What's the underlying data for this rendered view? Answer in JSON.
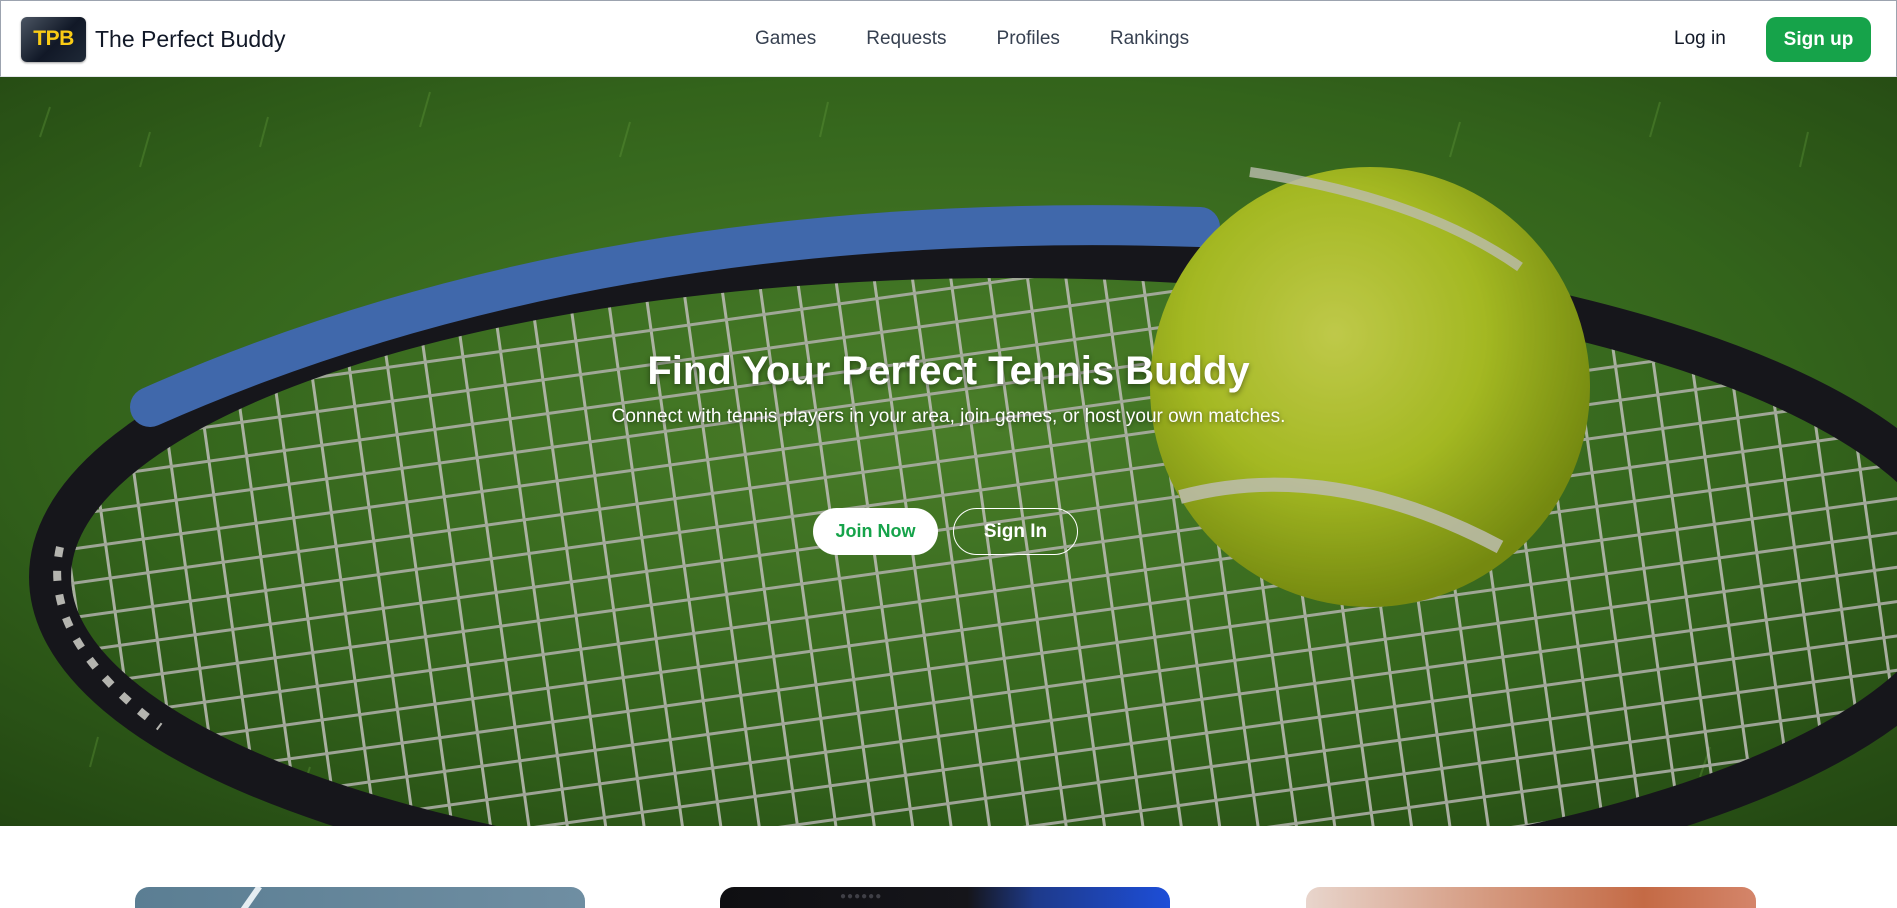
{
  "header": {
    "logo_text": "TPB",
    "brand_name": "The Perfect Buddy",
    "nav": [
      "Games",
      "Requests",
      "Profiles",
      "Rankings"
    ],
    "login_label": "Log in",
    "signup_label": "Sign up"
  },
  "hero": {
    "title": "Find Your Perfect Tennis Buddy",
    "subtitle": "Connect with tennis players in your area, join games, or host your own matches.",
    "join_label": "Join Now",
    "signin_label": "Sign In",
    "background_image": "tennis-racket-and-ball-on-grass"
  },
  "colors": {
    "accent": "#16a34a",
    "logo_text": "#facc15",
    "logo_bg": "#111827"
  }
}
